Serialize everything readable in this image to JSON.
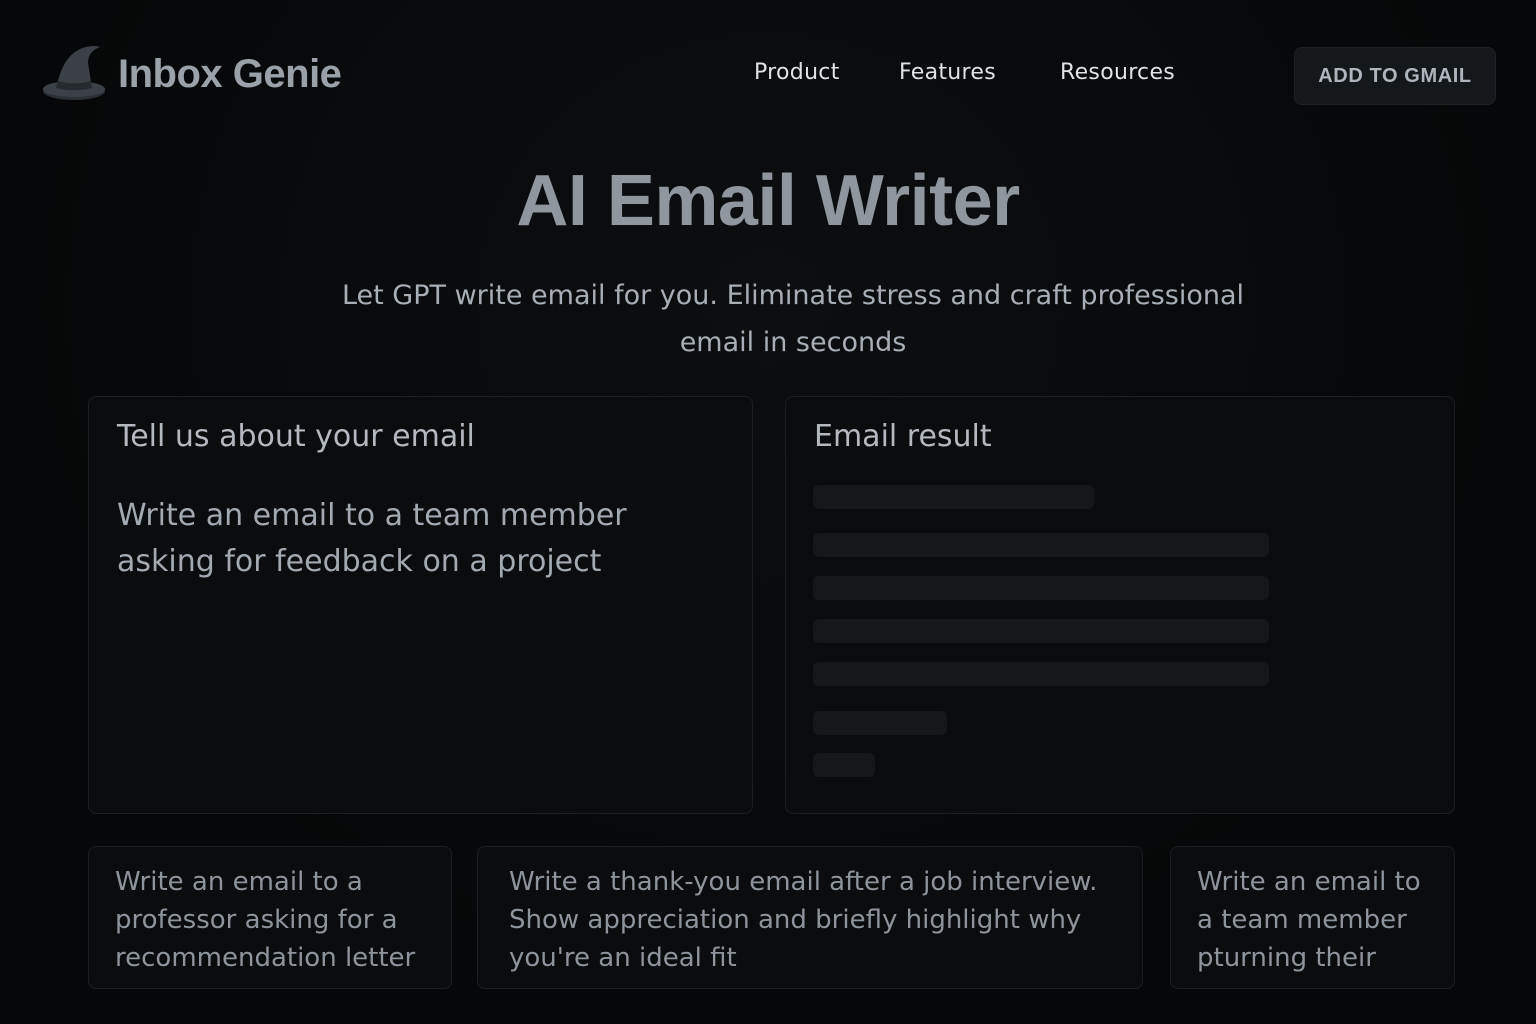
{
  "header": {
    "brand": "Inbox Genie",
    "logo_icon": "wizard-hat-icon",
    "nav": [
      "Product",
      "Features",
      "Resources"
    ],
    "cta_label": "ADD TO GMAIL"
  },
  "hero": {
    "title": "AI Email Writer",
    "subtitle_line1": "Let GPT write email for you. Eliminate stress and craft professional",
    "subtitle_line2": "email in seconds"
  },
  "input_panel": {
    "heading": "Tell us about your email",
    "value": "Write an email to a team member asking for feedback on a project"
  },
  "result_panel": {
    "heading": "Email result",
    "state": "loading"
  },
  "examples": [
    "Write an email to a professor asking for a recommendation letter",
    "Write a thank-you email after a job interview. Show appreciation and briefly highlight why you're an ideal fit",
    "Write an email to a team member pturning their"
  ],
  "colors": {
    "background": "#070809",
    "panel": "#0a0c0e",
    "border": "#1b1f23",
    "title": "#8f969e",
    "skeleton": "#14181b"
  }
}
